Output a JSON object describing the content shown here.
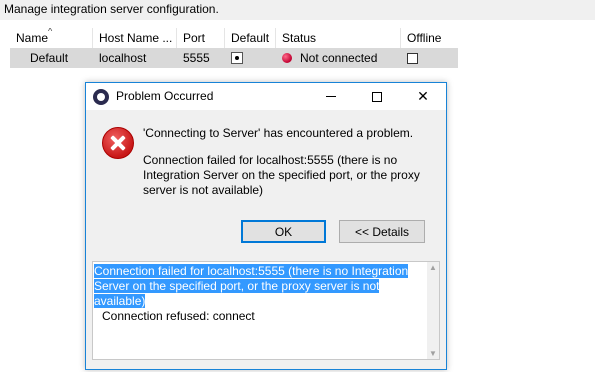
{
  "page": {
    "description": "Manage integration server configuration."
  },
  "table": {
    "columns": [
      "Name",
      "Host Name ...",
      "Port",
      "Default",
      "Status",
      "Offline"
    ],
    "rows": [
      {
        "name": "Default",
        "host": "localhost",
        "port": "5555",
        "default": true,
        "status": "Not connected",
        "offline": false
      }
    ]
  },
  "dialog": {
    "title": "Problem Occurred",
    "message": "'Connecting to Server' has encountered a problem.",
    "detail": "Connection failed for localhost:5555 (there is no Integration Server on the specified port, or the proxy server is not available)",
    "buttons": {
      "ok": "OK",
      "details": "<< Details"
    },
    "details_text": {
      "line1": "Connection failed for localhost:5555 (there is no Integration Server on the specified port, or the proxy server is not available)",
      "line2": "Connection refused: connect"
    }
  },
  "colors": {
    "accent": "#0078d7",
    "selection": "#3399ff",
    "status_disconnected": "#c00030"
  }
}
